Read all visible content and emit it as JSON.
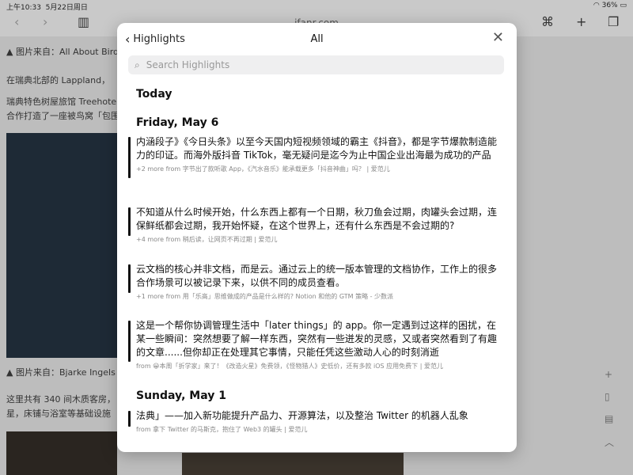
{
  "status": {
    "time": "上午10:33",
    "date": "5月22日周日",
    "battery": "36%"
  },
  "browser": {
    "url": "ifanr.com"
  },
  "background": {
    "caption1": "▲ 图片来自：All About Birds",
    "line1": "在瑞典北部的 Lappland，",
    "line2": "瑞典特色树屋旅馆 Treehote",
    "line3": "合作打造了一座被鸟窝「包围",
    "caption2": "▲ 图片来自：Bjarke Ingels Grou",
    "line4": "这里共有 340 间木质客房，",
    "line5": "星，床铺与浴室等基础设施"
  },
  "modal": {
    "back_label": "Highlights",
    "title": "All",
    "search_placeholder": "Search Highlights",
    "sections": [
      {
        "label": "Today"
      },
      {
        "label": "Friday, May 6"
      },
      {
        "label": "Sunday, May 1"
      }
    ],
    "highlights": [
      {
        "text": "内涵段子》《今日头条》以至今天国内短视频领域的霸主《抖音》，都是字节爆款制造能力的印证。而海外版抖音 TikTok，毫无疑问是迄今为止中国企业出海最为成功的产品",
        "meta": "+2 more from 字节出了款听歌 App，《汽水音乐》能承载更多「抖音神曲」吗？ | 爱范儿"
      },
      {
        "text": "不知道从什么时候开始，什么东西上都有一个日期，秋刀鱼会过期，肉罐头会过期，连保鲜纸都会过期，我开始怀疑，在这个世界上，还有什么东西是不会过期的?",
        "meta": "+4 more from 稍后读，让网页不再过期 | 爱范儿"
      },
      {
        "text": "云文档的核心并非文档，而是云。通过云上的统一版本管理的文档协作，工作上的很多合作场景可以被记录下来，以供不同的成员查看。",
        "meta": "+1 more from 用「乐高」思维做成的产品是什么样的? Notion 和他的 GTM 策略 - 少数派"
      },
      {
        "text": "这是一个帮你协调管理生活中「later things」的 app。你一定遇到过这样的困扰，在某一些瞬间：突然想要了解一样东西，突然有一些迸发的灵感，又或者突然看到了有趣的文章......但你却正在处理其它事情，只能任凭这些激动人心的时刻消逝",
        "meta": "from 😀本周「折学家」来了！《改造火星》免费领，《怪物猎人》史低价，还有多款 iOS 应用免费下 | 爱范儿"
      },
      {
        "text": "法典」——加入新功能提升产品力、开源算法，以及整治 Twitter 的机器人乱象",
        "meta": "from 拿下 Twitter 的马斯克，抱住了 Web3 的罐头 | 爱范儿"
      }
    ]
  }
}
